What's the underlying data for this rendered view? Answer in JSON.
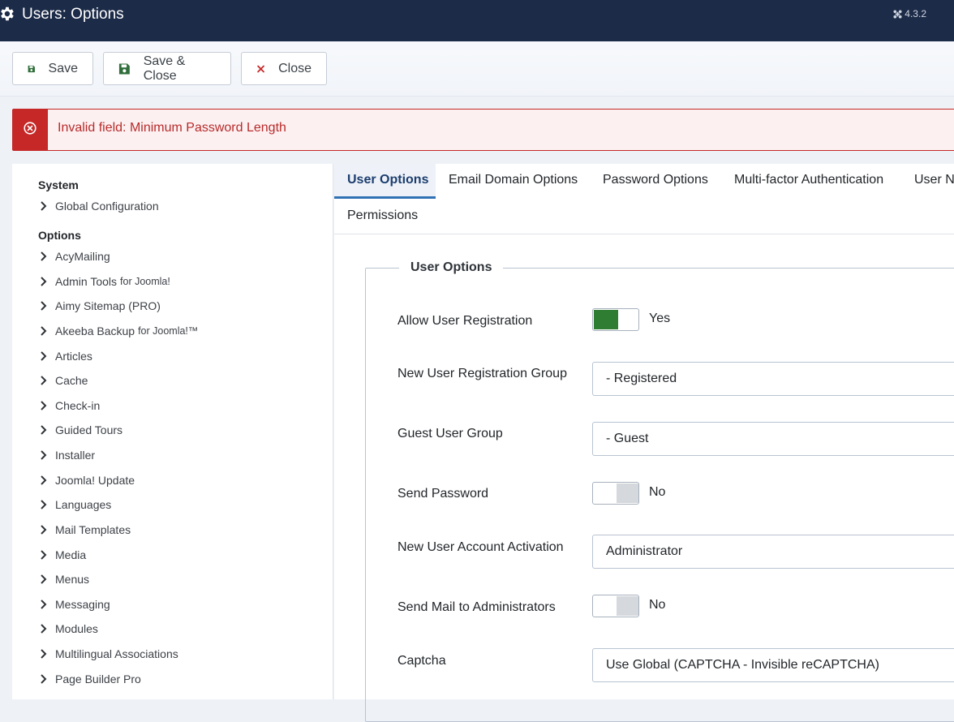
{
  "header": {
    "title": "Users: Options",
    "version": "4.3.2"
  },
  "toolbar": {
    "save_label": "Save",
    "save_close_label": "Save & Close",
    "close_label": "Close"
  },
  "alert": {
    "message": "Invalid field: Minimum Password Length"
  },
  "sidebar": {
    "system_heading": "System",
    "system_items": [
      {
        "label": "Global Configuration"
      }
    ],
    "options_heading": "Options",
    "items": [
      {
        "label": "AcyMailing",
        "suffix": ""
      },
      {
        "label": "Admin Tools",
        "suffix": "for Joomla!"
      },
      {
        "label": "Aimy Sitemap (PRO)",
        "suffix": ""
      },
      {
        "label": "Akeeba Backup",
        "suffix": "for Joomla!™"
      },
      {
        "label": "Articles",
        "suffix": ""
      },
      {
        "label": "Cache",
        "suffix": ""
      },
      {
        "label": "Check-in",
        "suffix": ""
      },
      {
        "label": "Guided Tours",
        "suffix": ""
      },
      {
        "label": "Installer",
        "suffix": ""
      },
      {
        "label": "Joomla! Update",
        "suffix": ""
      },
      {
        "label": "Languages",
        "suffix": ""
      },
      {
        "label": "Mail Templates",
        "suffix": ""
      },
      {
        "label": "Media",
        "suffix": ""
      },
      {
        "label": "Menus",
        "suffix": ""
      },
      {
        "label": "Messaging",
        "suffix": ""
      },
      {
        "label": "Modules",
        "suffix": ""
      },
      {
        "label": "Multilingual Associations",
        "suffix": ""
      },
      {
        "label": "Page Builder Pro",
        "suffix": ""
      }
    ]
  },
  "tabs": [
    {
      "label": "User Options",
      "active": true
    },
    {
      "label": "Email Domain Options"
    },
    {
      "label": "Password Options"
    },
    {
      "label": "Multi-factor Authentication"
    },
    {
      "label": "User N"
    },
    {
      "label": "Permissions"
    }
  ],
  "form": {
    "legend": "User Options",
    "allow_registration": {
      "label": "Allow User Registration",
      "value": "Yes"
    },
    "new_user_group": {
      "label": "New User Registration Group",
      "value": "- Registered"
    },
    "guest_group": {
      "label": "Guest User Group",
      "value": "- Guest"
    },
    "send_password": {
      "label": "Send Password",
      "value": "No"
    },
    "account_activation": {
      "label": "New User Account Activation",
      "value": "Administrator"
    },
    "send_mail_admins": {
      "label": "Send Mail to Administrators",
      "value": "No"
    },
    "captcha": {
      "label": "Captcha",
      "value": "Use Global (CAPTCHA - Invisible reCAPTCHA)"
    }
  }
}
